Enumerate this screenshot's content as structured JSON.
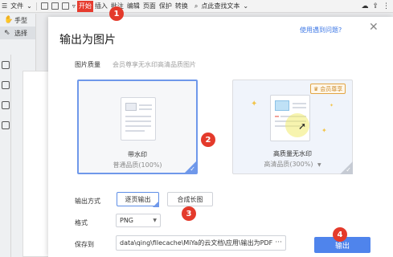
{
  "toolbar": {
    "file_label": "文件",
    "start_tab": "开始",
    "tabs": [
      "插入",
      "批注",
      "编辑",
      "页面",
      "保护",
      "转换"
    ],
    "search_label": "点此查找文本"
  },
  "left_panel": {
    "hand_tool": "手型",
    "select_tool": "选择"
  },
  "dialog": {
    "title": "输出为图片",
    "help_link": "使用遇到问题?",
    "quality_label": "图片质量",
    "quality_note": "会员尊享无水印高清品质图片",
    "options": [
      {
        "name": "带水印",
        "detail": "普通品质(100%)"
      },
      {
        "name": "高质量无水印",
        "detail": "高清品质(300%)",
        "badge": "会员尊享"
      }
    ],
    "output_label": "输出方式",
    "output_modes": [
      "逐页输出",
      "合成长图"
    ],
    "format_label": "格式",
    "format_value": "PNG",
    "save_label": "保存到",
    "save_path": "data\\qing\\filecache\\MiYa的云文档\\应用\\输出为PDF\\",
    "export_button": "输出"
  },
  "steps": [
    "1",
    "2",
    "3",
    "4"
  ],
  "colors": {
    "accent": "#4f84ec",
    "step_red": "#e43a2b",
    "start_tab": "#e63b2e",
    "member_gold": "#cb8b2a"
  }
}
